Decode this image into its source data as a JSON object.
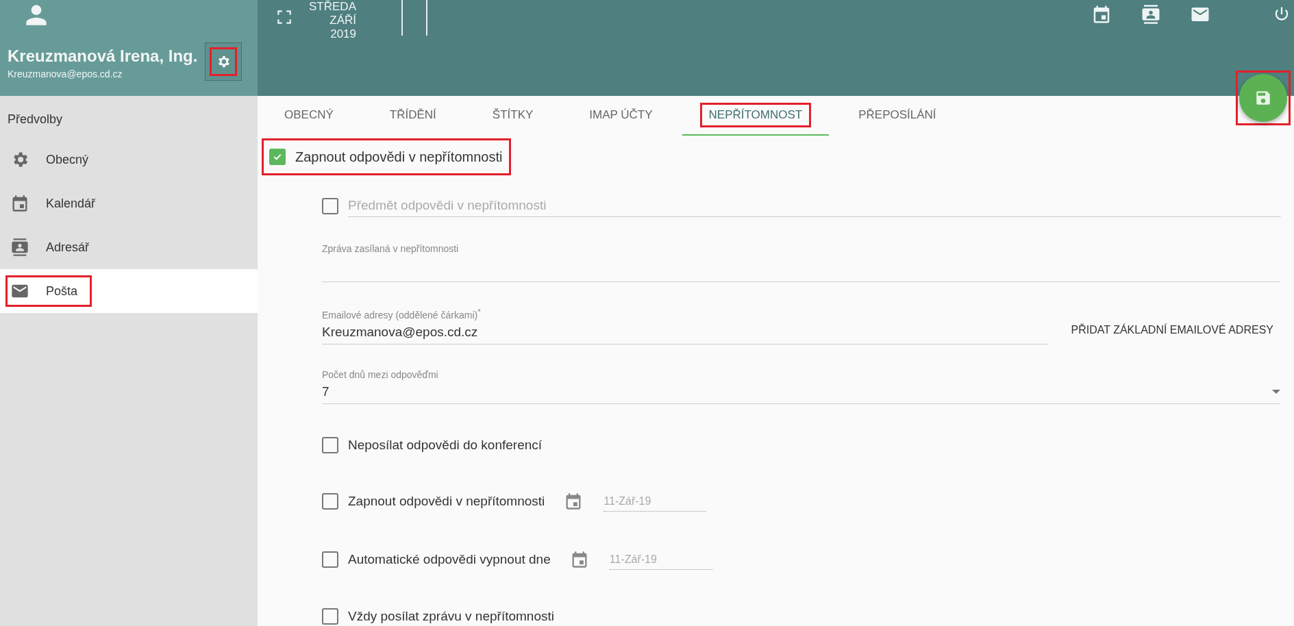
{
  "user": {
    "name": "Kreuzmanová Irena, Ing.",
    "email": "Kreuzmanova@epos.cd.cz",
    "settings_highlighted": true
  },
  "topbar": {
    "date_lines": [
      "STŘEDA",
      "ZÁŘÍ",
      "2019"
    ]
  },
  "sidebar": {
    "title": "Předvolby",
    "items": [
      {
        "label": "Obecný",
        "selected": false,
        "highlighted": false
      },
      {
        "label": "Kalendář",
        "selected": false,
        "highlighted": false
      },
      {
        "label": "Adresář",
        "selected": false,
        "highlighted": false
      },
      {
        "label": "Pošta",
        "selected": true,
        "highlighted": true
      }
    ]
  },
  "tabs": [
    {
      "label": "OBECNÝ",
      "selected": false,
      "highlighted": false
    },
    {
      "label": "TŘÍDĚNÍ",
      "selected": false,
      "highlighted": false
    },
    {
      "label": "ŠTÍTKY",
      "selected": false,
      "highlighted": false
    },
    {
      "label": "IMAP ÚČTY",
      "selected": false,
      "highlighted": false
    },
    {
      "label": "NEPŘÍTOMNOST",
      "selected": true,
      "highlighted": true
    },
    {
      "label": "PŘEPOSÍLÁNÍ",
      "selected": false,
      "highlighted": false
    }
  ],
  "save_highlighted": true,
  "form": {
    "enable": {
      "label": "Zapnout odpovědi v nepřítomnosti",
      "checked": true,
      "highlighted": true
    },
    "subject": {
      "checked": false,
      "placeholder": "Předmět odpovědi v nepřítomnosti"
    },
    "message": {
      "label": "Zpráva zasílaná v nepřítomnosti"
    },
    "emails": {
      "label": "Emailové adresy (oddělené čárkami)$^{*}$",
      "value": "Kreuzmanova@epos.cd.cz",
      "button": "PŘIDAT ZÁKLADNÍ EMAILOVÉ ADRESY"
    },
    "days": {
      "label": "Počet dnů mezi odpověďmi",
      "value": "7"
    },
    "options": [
      {
        "kind": "checkbox",
        "label": "Neposílat odpovědi do konferencí",
        "checked": false
      },
      {
        "kind": "date",
        "label": "Zapnout odpovědi v nepřítomnosti",
        "checked": false,
        "date": "11-Zář-19"
      },
      {
        "kind": "date",
        "label": "Automatické odpovědi vypnout dne",
        "checked": false,
        "date": "11-Zář-19"
      },
      {
        "kind": "checkbox",
        "label": "Vždy posílat zprávu v nepřítomnosti",
        "checked": false
      }
    ]
  }
}
